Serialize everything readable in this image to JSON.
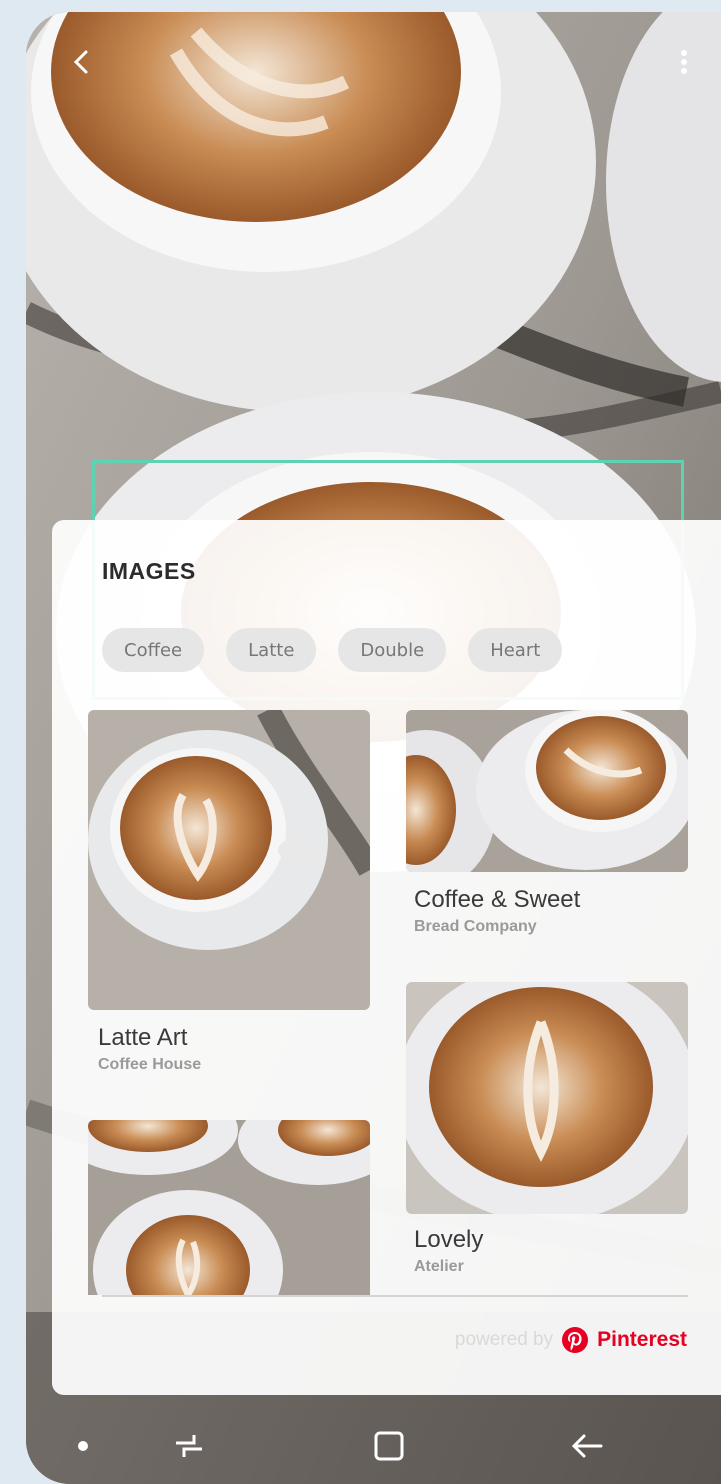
{
  "images_panel": {
    "title": "IMAGES",
    "chips": [
      "Coffee",
      "Latte",
      "Double",
      "Heart"
    ],
    "results": [
      {
        "title": "Latte Art",
        "subtitle": "Coffee House"
      },
      {
        "title": "Coffee & Sweet",
        "subtitle": "Bread Company"
      },
      {
        "title": "Lovely",
        "subtitle": "Atelier"
      },
      {
        "title": "",
        "subtitle": ""
      }
    ],
    "powered_by": "powered by",
    "brand": "Pinterest",
    "brand_color": "#e60023"
  },
  "icons": {
    "back": "chevron-left-icon",
    "more": "more-vertical-icon",
    "nav": [
      "dot-icon",
      "recent-apps-icon",
      "home-square-icon",
      "back-arrow-icon"
    ]
  },
  "colors": {
    "selection": "#5fd2b4",
    "panel": "#ffffff"
  }
}
